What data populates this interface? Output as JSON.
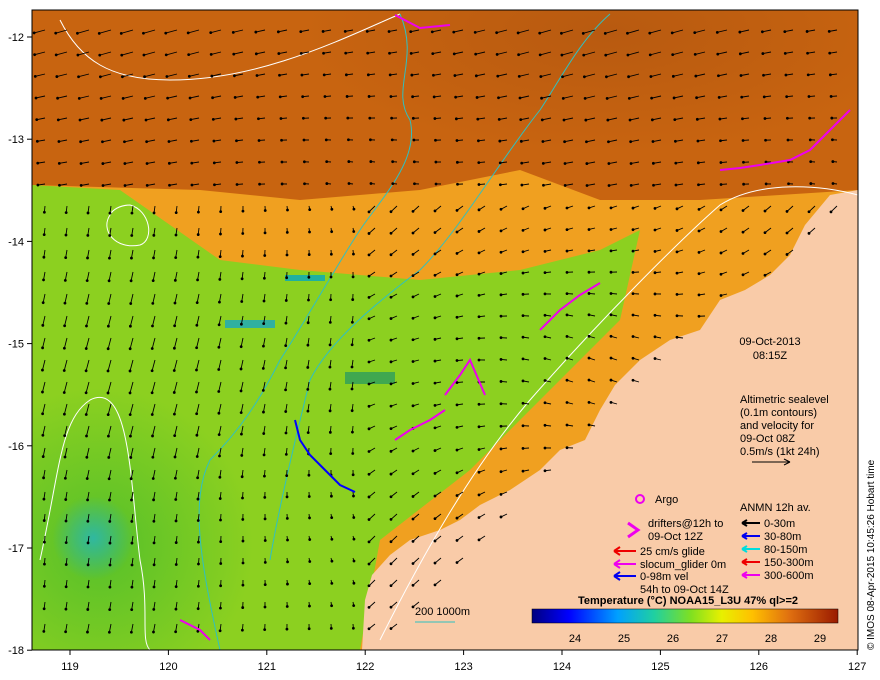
{
  "map": {
    "date": "09-Oct-2013",
    "time": "08:15Z",
    "x_ticks": [
      "119",
      "120",
      "121",
      "122",
      "123",
      "124",
      "125",
      "126",
      "127"
    ],
    "y_ticks": [
      "-12",
      "-13",
      "-14",
      "-15",
      "-16",
      "-17",
      "-18"
    ]
  },
  "altimetry_note": {
    "line1": "Altimetric sealevel",
    "line2": "(0.1m contours)",
    "line3": "and velocity for",
    "line4": "09-Oct 08Z",
    "line5": "0.5m/s (1kt 24h)"
  },
  "legend_left": {
    "argo": "Argo",
    "drifters1": "drifters@12h to",
    "drifters2": "09-Oct 12Z",
    "glide": "25 cm/s glide",
    "slocum": "slocum_glider 0m",
    "vel1": "0-98m vel",
    "vel2": "54h to 09-Oct 14Z"
  },
  "legend_anmn": {
    "title": "ANMN 12h av.",
    "items": [
      {
        "label": "0-30m",
        "color": "#000000"
      },
      {
        "label": "30-80m",
        "color": "#0000ee"
      },
      {
        "label": "80-150m",
        "color": "#00dddd"
      },
      {
        "label": "150-300m",
        "color": "#ee0000"
      },
      {
        "label": "300-600m",
        "color": "#ee00ee"
      }
    ]
  },
  "bathymetry_label": "200  1000m",
  "colorbar": {
    "title": "Temperature (°C) NOAA15_L3U 47% ql>=2",
    "ticks": [
      "24",
      "25",
      "26",
      "27",
      "28",
      "29"
    ]
  },
  "credit": "© IMOS 08-Apr-2015 10:45:26 Hobart time",
  "colors": {
    "land": "#f9cba8",
    "sst_warm": "#c86410",
    "sst_mid": "#f0a020",
    "sst_cool": "#8cd020",
    "sst_cold": "#20b0c0",
    "contour": "#ffffff",
    "isobath": "#30c0c0"
  }
}
